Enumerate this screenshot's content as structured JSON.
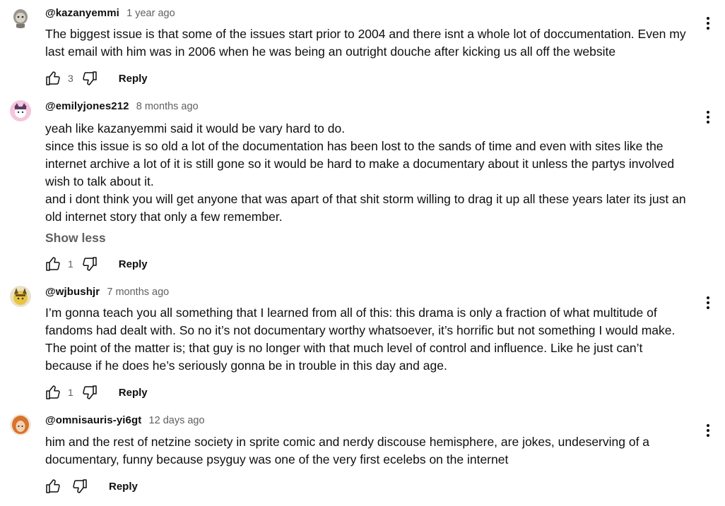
{
  "comments": [
    {
      "author": "@kazanyemmi",
      "time": "1 year ago",
      "avatar_icon": "cartoon-head-avatar",
      "lines": [
        "The biggest issue is that some of the issues start prior to 2004 and there isnt a whole lot of doccumentation. Even my",
        "last email with him was in 2006 when he was being an outright douche after kicking us all off the website"
      ],
      "likes": "3",
      "reply_label": "Reply"
    },
    {
      "author": "@emilyjones212",
      "time": "8 months ago",
      "avatar_icon": "pink-character-avatar",
      "lines": [
        "yeah like kazanyemmi said it would be vary hard to do.",
        "since this issue is so old a lot of the documentation has been lost to the sands of time and even with sites like the",
        "internet archive a lot of it is still gone so it would be hard to make a documentary about it unless the partys involved",
        "wish to talk about it.",
        "and i dont think you will get anyone that was apart of that shit storm willing to drag it up all these years later its just an",
        "old internet story that only a few remember."
      ],
      "show_less": "Show less",
      "likes": "1",
      "reply_label": "Reply"
    },
    {
      "author": "@wjbushjr",
      "time": "7 months ago",
      "avatar_icon": "yellow-character-avatar",
      "lines": [
        "I’m gonna teach you all something that I learned from all of this: this drama is only a fraction of what multitude of",
        "fandoms had dealt with. So no it’s not documentary worthy whatsoever, it’s horrific but not something I would make.",
        "The point of the matter is; that guy is no longer with that much level of control and influence. Like he just can’t",
        "because if he does he’s seriously gonna be in trouble in this day and age."
      ],
      "likes": "1",
      "reply_label": "Reply"
    },
    {
      "author": "@omnisauris-yi6gt",
      "time": "12 days ago",
      "avatar_icon": "orange-hair-avatar",
      "lines": [
        "him and the rest of netzine society in sprite comic and nerdy discouse hemisphere, are jokes, undeserving of a",
        "documentary, funny because psyguy was one of the very first ecelebs on the internet"
      ],
      "likes": "",
      "reply_label": "Reply"
    }
  ]
}
